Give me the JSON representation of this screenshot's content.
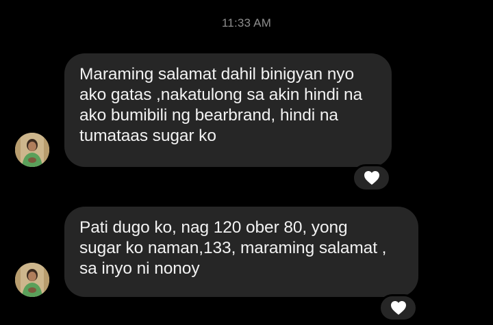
{
  "conversation": {
    "timestamp": "11:33 AM",
    "messages": [
      {
        "text": "Maraming salamat dahil binigyan nyo\nako gatas ,nakatulong sa akin hindi na\nako bumibili ng bearbrand, hindi na\ntumataas sugar ko",
        "reaction_icon": "heart-icon"
      },
      {
        "text": "Pati dugo ko, nag 120 ober 80, yong\nsugar ko naman,133, maraming salamat ,\nsa inyo ni nonoy",
        "reaction_icon": "heart-icon"
      }
    ]
  },
  "colors": {
    "background": "#000000",
    "bubble": "#262626",
    "text": "#f2f2f2",
    "timestamp": "#8e8e8e",
    "heart": "#ffffff"
  }
}
